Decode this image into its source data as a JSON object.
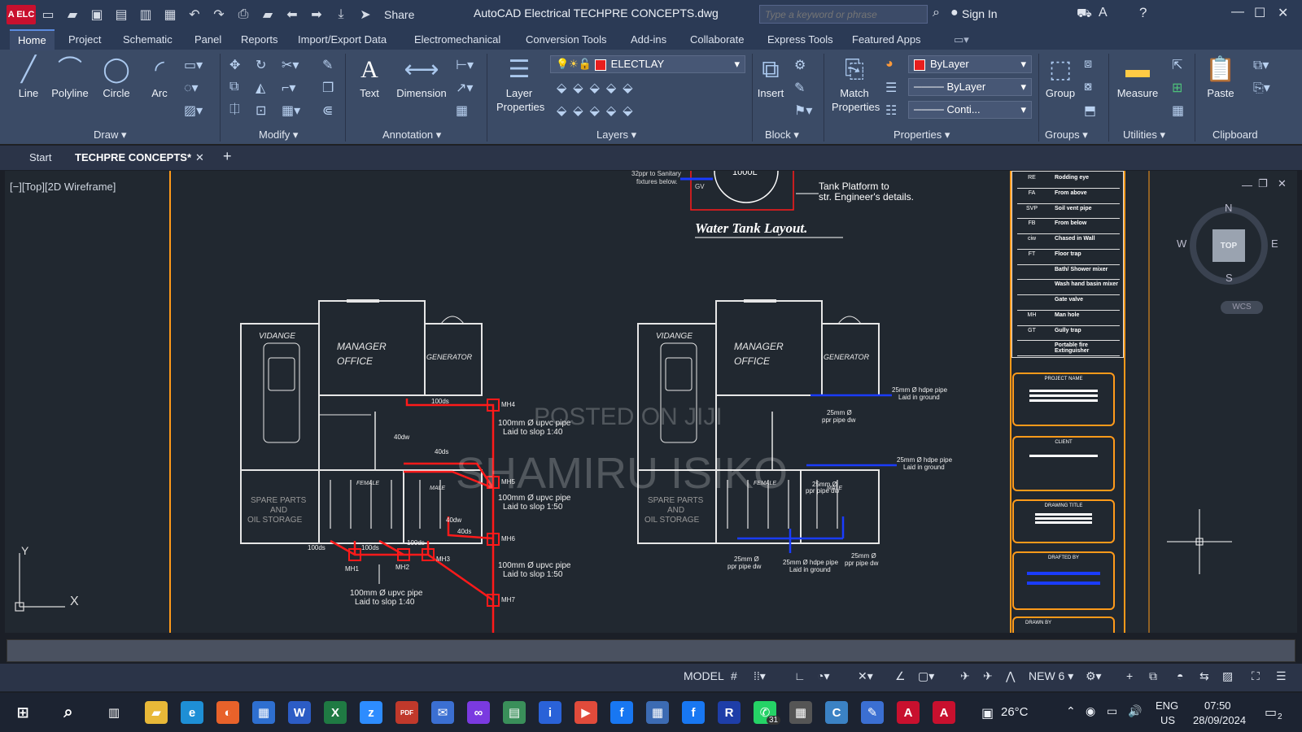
{
  "titlebar": {
    "app_logo": "A ELC",
    "share": "Share",
    "title": "AutoCAD Electrical    TECHPRE CONCEPTS.dwg",
    "search_placeholder": "Type a keyword or phrase",
    "signin": "Sign In"
  },
  "menu": [
    "Home",
    "Project",
    "Schematic",
    "Panel",
    "Reports",
    "Import/Export Data",
    "Electromechanical",
    "Conversion Tools",
    "Add-ins",
    "Collaborate",
    "Express Tools",
    "Featured Apps"
  ],
  "ribbon": {
    "draw": {
      "line": "Line",
      "polyline": "Polyline",
      "circle": "Circle",
      "arc": "Arc",
      "title": "Draw"
    },
    "modify_title": "Modify",
    "annotation": {
      "text": "Text",
      "dimension": "Dimension",
      "title": "Annotation"
    },
    "layers": {
      "layer_properties": "Layer Properties",
      "current_layer": "ELECTLAY",
      "title": "Layers"
    },
    "block": {
      "insert": "Insert",
      "title": "Block"
    },
    "properties": {
      "match": "Match Properties",
      "color": "ByLayer",
      "lineweight": "ByLayer",
      "linetype": "Conti...",
      "title": "Properties"
    },
    "groups": {
      "group": "Group",
      "title": "Groups"
    },
    "utilities": {
      "measure": "Measure",
      "title": "Utilities"
    },
    "clipboard": {
      "paste": "Paste",
      "title": "Clipboard"
    }
  },
  "tabs": {
    "start": "Start",
    "active": "TECHPRE CONCEPTS*"
  },
  "viewport": {
    "label": "[−][Top][2D Wireframe]",
    "compass": {
      "n": "N",
      "s": "S",
      "e": "E",
      "w": "W",
      "top": "TOP",
      "wcs": "WCS"
    },
    "ucs": {
      "x": "X",
      "y": "Y"
    },
    "plan": {
      "tank_note1": "32ppr to Sanitary",
      "tank_note2": "fixtures below.",
      "gv": "GV",
      "tank_label": "1000L",
      "platform1": "Tank Platform to",
      "platform2": "str. Engineer's details.",
      "tank_title": "Water Tank Layout.",
      "rooms": {
        "vidange": "VIDANGE",
        "manager1": "MANAGER",
        "manager2": "OFFICE",
        "generator": "GENERATOR",
        "spare1": "SPARE PARTS",
        "spare2": "AND",
        "spare3": "OIL STORAGE",
        "female": "FEMALE",
        "male": "MALE"
      },
      "pipes": {
        "p1a": "100mm Ø upvc pipe",
        "p1b": "Laid to slop 1:40",
        "p2a": "100mm Ø upvc pipe",
        "p2b": "Laid to slop 1:50",
        "p3a": "100mm Ø upvc pipe",
        "p3b": "Laid to slop 1:50",
        "p4a": "100mm Ø upvc pipe",
        "p4b": "Laid to slop 1:40"
      },
      "mh": {
        "mh1": "MH1",
        "mh2": "MH2",
        "mh3": "MH3",
        "mh4": "MH4",
        "mh5": "MH5",
        "mh6": "MH6",
        "mh7": "MH7"
      },
      "dims": {
        "d100": "100ds",
        "d40": "40dw",
        "d40s": "40ds"
      },
      "water": {
        "w1a": "25mm Ø hdpe pipe",
        "w1b": "Laid in ground",
        "w2a": "25mm Ø",
        "w2b": "ppr pipe dw",
        "w3a": "25mm Ø hdpe pipe",
        "w3b": "Laid in ground",
        "w4a": "25mm Ø",
        "w4b": "ppr pipe dw",
        "w5a": "25mm Ø",
        "w5b": "ppr pipe dw",
        "w6a": "25mm Ø hdpe pipe",
        "w6b": "Laid in ground",
        "w7a": "25mm Ø",
        "w7b": "ppr pipe dw"
      },
      "watermark1": "POSTED ON JIJI",
      "watermark2": "SHAMIRU ISIKO"
    },
    "legend": [
      {
        "code": "RE",
        "text": "Rodding eye"
      },
      {
        "code": "FA",
        "text": "From above"
      },
      {
        "code": "SVP",
        "text": "Soil vent pipe"
      },
      {
        "code": "FB",
        "text": "From below"
      },
      {
        "code": "ciw",
        "text": "Chased in Wall"
      },
      {
        "code": "FT",
        "text": "Floor trap"
      },
      {
        "code": "",
        "text": "Bath/ Shower mixer"
      },
      {
        "code": "",
        "text": "Wash hand basin mixer"
      },
      {
        "code": "",
        "text": "Gate valve"
      },
      {
        "code": "MH",
        "text": "Man hole"
      },
      {
        "code": "GT",
        "text": "Gully trap"
      },
      {
        "code": "",
        "text": "Portable fire Extinguisher"
      }
    ],
    "titleblock": {
      "project": "PROJECT NAME",
      "client": "CLIENT",
      "drawing": "DRAWING TITLE",
      "drafted": "DRAFTED BY",
      "drawn": "DRAWN BY"
    }
  },
  "status": {
    "model": "MODEL",
    "anno": "NEW 6"
  },
  "taskbar": {
    "temp": "26°C",
    "lang1": "ENG",
    "lang2": "US",
    "time": "07:50",
    "date": "28/09/2024",
    "badge": "31",
    "notif": "2"
  },
  "colors": {
    "accent": "#2b3a55",
    "drain": "#ff1a1a",
    "water": "#1a3cff",
    "titleblock": "#ff9a1a"
  }
}
